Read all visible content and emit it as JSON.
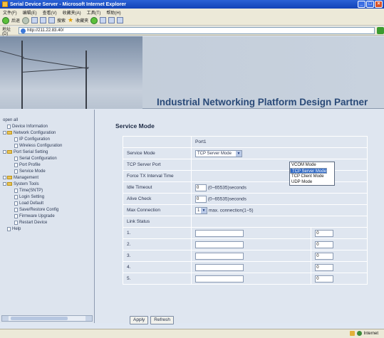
{
  "window": {
    "title": "Serial Device Server - Microsoft Internet Explorer"
  },
  "menu": [
    "文件(F)",
    "编辑(E)",
    "查看(V)",
    "收藏夹(A)",
    "工具(T)",
    "帮助(H)"
  ],
  "toolbar": {
    "back": "后退",
    "search": "搜索",
    "favorites": "收藏夹"
  },
  "address": {
    "label": "地址(D)",
    "url": "http://211.22.83.40/"
  },
  "header": {
    "title": "Industrial Networking Platform Design Partner"
  },
  "nav": {
    "items": [
      {
        "label": "open all",
        "level": 0
      },
      {
        "label": "Device Information",
        "level": 1
      },
      {
        "label": "Network Configuration",
        "level": 1
      },
      {
        "label": "IP Configuration",
        "level": 2
      },
      {
        "label": "Wireless Configuration",
        "level": 2
      },
      {
        "label": "Port Serial Setting",
        "level": 1
      },
      {
        "label": "Serial Configuration",
        "level": 2
      },
      {
        "label": "Port Profile",
        "level": 2
      },
      {
        "label": "Service Mode",
        "level": 2
      },
      {
        "label": "Management",
        "level": 1
      },
      {
        "label": "System Tools",
        "level": 1
      },
      {
        "label": "Time(SNTP)",
        "level": 2
      },
      {
        "label": "Login Setting",
        "level": 2
      },
      {
        "label": "Load Default",
        "level": 2
      },
      {
        "label": "Save/Restore Config",
        "level": 2
      },
      {
        "label": "Firmware Upgrade",
        "level": 2
      },
      {
        "label": "Restart Device",
        "level": 2
      },
      {
        "label": "Help",
        "level": 1
      }
    ]
  },
  "main": {
    "title": "Service Mode",
    "port_header": "Port1",
    "service_mode": {
      "label": "Service Mode",
      "value": "TCP Server Mode"
    },
    "dropdown_options": [
      "VCOM Mode",
      "TCP Server Mode",
      "TCP Client Mode",
      "UDP Mode"
    ],
    "tcp_server_port": {
      "label": "TCP Server Port"
    },
    "force_tx": {
      "label": "Force TX Interval Time"
    },
    "idle_timeout": {
      "label": "Idle Timeout",
      "value": "0",
      "hint": "(0~65535)seconds"
    },
    "alive_check": {
      "label": "Alive Check",
      "value": "0",
      "hint": "(0~65535)seconds"
    },
    "max_connection": {
      "label": "Max Connection",
      "value": "1",
      "hint": "max. connection(1~5)"
    },
    "link_status": {
      "label": "Link Status"
    },
    "link_rows": [
      {
        "num": "1.",
        "status": "0"
      },
      {
        "num": "2.",
        "status": "0"
      },
      {
        "num": "3.",
        "status": "0"
      },
      {
        "num": "4.",
        "status": "0"
      },
      {
        "num": "5.",
        "status": "0"
      }
    ],
    "apply_label": "Apply",
    "refresh_label": "Refresh"
  },
  "statusbar": {
    "zone": "Internet"
  }
}
